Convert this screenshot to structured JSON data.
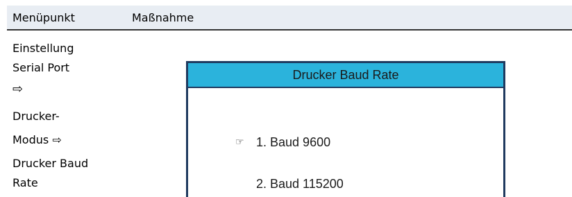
{
  "table_header": {
    "col_menu": "Menüpunkt",
    "col_action": "Maßnahme"
  },
  "menu_path": {
    "lines": [
      "Einstellung",
      "Serial Port",
      "⇨",
      "Drucker-",
      "Modus ⇨",
      "Drucker Baud",
      "Rate"
    ]
  },
  "screen": {
    "title": "Drucker Baud Rate",
    "pointer_icon": "☞",
    "options": [
      "1. Baud 9600",
      "2. Baud 115200"
    ],
    "selected_index": 0,
    "title_bar_color": "#2bb3dc",
    "frame_color": "#1f3a5f"
  }
}
